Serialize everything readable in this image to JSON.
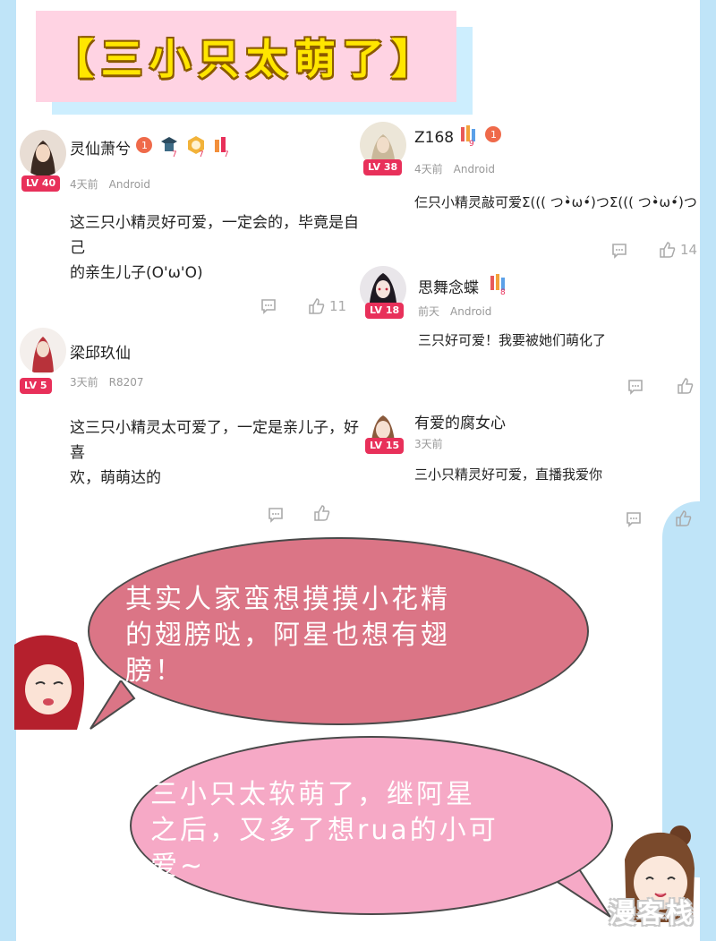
{
  "banner": {
    "title": "【三小只太萌了】"
  },
  "comments": [
    {
      "user": "灵仙萧兮",
      "level": "LV 40",
      "time": "4天前",
      "device": "Android",
      "text_line1": "这三只小精灵好可爱，一定会的，毕竟是自己",
      "text_line2": "的亲生儿子(O'ω'O)",
      "likes": "11"
    },
    {
      "user": "梁邱玖仙",
      "level": "LV 5",
      "time": "3天前",
      "device": "R8207",
      "text_line1": "这三只小精灵太可爱了，一定是亲儿子，好喜",
      "text_line2": "欢，萌萌达的",
      "likes": ""
    },
    {
      "user": "Z168",
      "level": "LV 38",
      "time": "4天前",
      "device": "Android",
      "text_line1": "仨只小精灵敲可爱Σ((( つ•̀ω•́)つΣ((( つ•̀ω•́)つ",
      "likes": "14"
    },
    {
      "user": "思舞念蝶",
      "level": "LV 18",
      "time": "前天",
      "device": "Android",
      "text_line1": "三只好可爱！我要被她们萌化了",
      "likes": ""
    },
    {
      "user": "有爱的腐女心",
      "level": "LV 15",
      "time": "3天前",
      "device": "",
      "text_line1": "三小只精灵好可爱，直播我爱你",
      "likes": ""
    }
  ],
  "bubbles": [
    {
      "line1": "其实人家蛮想摸摸小花精",
      "line2": "的翅膀哒，阿星也想有翅",
      "line3": "膀！"
    },
    {
      "line1": "三小只太软萌了，继阿星",
      "line2": "之后，又多了想rua的小可",
      "line3": "爱~"
    }
  ],
  "watermark": "漫客栈",
  "colors": {
    "level_badge": "#e8305a",
    "banner_bg": "#ffd3e3",
    "banner_text": "#ffe600",
    "bubble1": "#db7586",
    "bubble2": "#f6a9c6",
    "side": "#bfe4f8"
  },
  "icons": [
    "comment-icon",
    "thumb-up-icon",
    "medal-icon"
  ]
}
